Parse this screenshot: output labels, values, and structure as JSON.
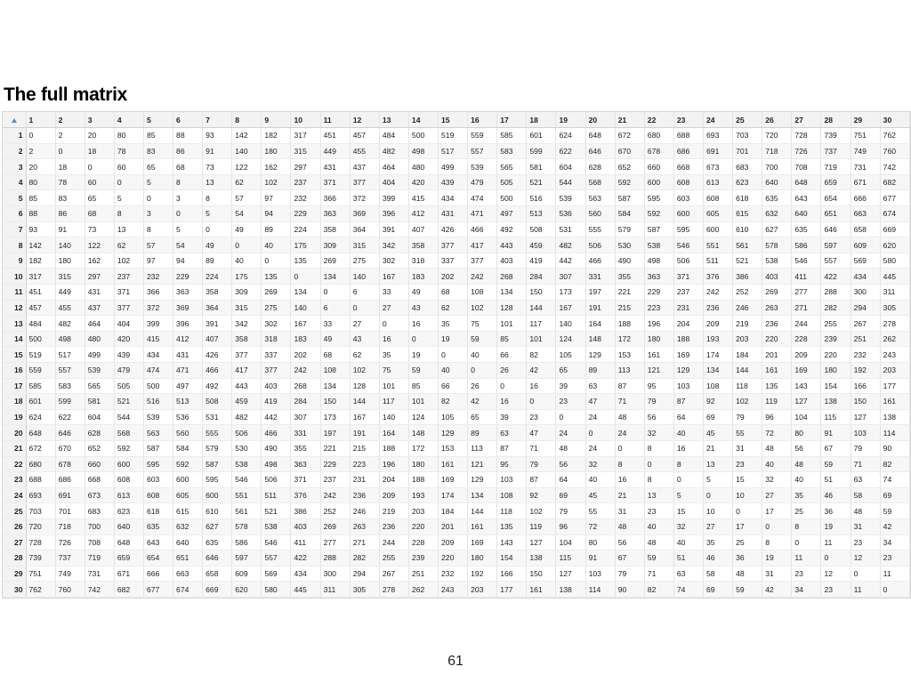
{
  "slide": {
    "title": "The full matrix",
    "page_number": "61"
  },
  "matrix": {
    "corner_icon": "sort-ascending-icon",
    "columns": [
      "1",
      "2",
      "3",
      "4",
      "5",
      "6",
      "7",
      "8",
      "9",
      "10",
      "11",
      "12",
      "13",
      "14",
      "15",
      "16",
      "17",
      "18",
      "19",
      "20",
      "21",
      "22",
      "23",
      "24",
      "25",
      "26",
      "27",
      "28",
      "29",
      "30"
    ],
    "rows": [
      {
        "label": "1",
        "cells": [
          0,
          2,
          20,
          80,
          85,
          88,
          93,
          142,
          182,
          317,
          451,
          457,
          484,
          500,
          519,
          559,
          585,
          601,
          624,
          648,
          672,
          680,
          688,
          693,
          703,
          720,
          728,
          739,
          751,
          762
        ]
      },
      {
        "label": "2",
        "cells": [
          2,
          0,
          18,
          78,
          83,
          86,
          91,
          140,
          180,
          315,
          449,
          455,
          482,
          498,
          517,
          557,
          583,
          599,
          622,
          646,
          670,
          678,
          686,
          691,
          701,
          718,
          726,
          737,
          749,
          760
        ]
      },
      {
        "label": "3",
        "cells": [
          20,
          18,
          0,
          60,
          65,
          68,
          73,
          122,
          162,
          297,
          431,
          437,
          464,
          480,
          499,
          539,
          565,
          581,
          604,
          628,
          652,
          660,
          668,
          673,
          683,
          700,
          708,
          719,
          731,
          742
        ]
      },
      {
        "label": "4",
        "cells": [
          80,
          78,
          60,
          0,
          5,
          8,
          13,
          62,
          102,
          237,
          371,
          377,
          404,
          420,
          439,
          479,
          505,
          521,
          544,
          568,
          592,
          600,
          608,
          613,
          623,
          640,
          648,
          659,
          671,
          682
        ]
      },
      {
        "label": "5",
        "cells": [
          85,
          83,
          65,
          5,
          0,
          3,
          8,
          57,
          97,
          232,
          366,
          372,
          399,
          415,
          434,
          474,
          500,
          516,
          539,
          563,
          587,
          595,
          603,
          608,
          618,
          635,
          643,
          654,
          666,
          677
        ]
      },
      {
        "label": "6",
        "cells": [
          88,
          86,
          68,
          8,
          3,
          0,
          5,
          54,
          94,
          229,
          363,
          369,
          396,
          412,
          431,
          471,
          497,
          513,
          536,
          560,
          584,
          592,
          600,
          605,
          615,
          632,
          640,
          651,
          663,
          674
        ]
      },
      {
        "label": "7",
        "cells": [
          93,
          91,
          73,
          13,
          8,
          5,
          0,
          49,
          89,
          224,
          358,
          364,
          391,
          407,
          426,
          466,
          492,
          508,
          531,
          555,
          579,
          587,
          595,
          600,
          610,
          627,
          635,
          646,
          658,
          669
        ]
      },
      {
        "label": "8",
        "cells": [
          142,
          140,
          122,
          62,
          57,
          54,
          49,
          0,
          40,
          175,
          309,
          315,
          342,
          358,
          377,
          417,
          443,
          459,
          482,
          506,
          530,
          538,
          546,
          551,
          561,
          578,
          586,
          597,
          609,
          620
        ]
      },
      {
        "label": "9",
        "cells": [
          182,
          180,
          162,
          102,
          97,
          94,
          89,
          40,
          0,
          135,
          269,
          275,
          302,
          318,
          337,
          377,
          403,
          419,
          442,
          466,
          490,
          498,
          506,
          511,
          521,
          538,
          546,
          557,
          569,
          580
        ]
      },
      {
        "label": "10",
        "cells": [
          317,
          315,
          297,
          237,
          232,
          229,
          224,
          175,
          135,
          0,
          134,
          140,
          167,
          183,
          202,
          242,
          268,
          284,
          307,
          331,
          355,
          363,
          371,
          376,
          386,
          403,
          411,
          422,
          434,
          445
        ]
      },
      {
        "label": "11",
        "cells": [
          451,
          449,
          431,
          371,
          366,
          363,
          358,
          309,
          269,
          134,
          0,
          6,
          33,
          49,
          68,
          108,
          134,
          150,
          173,
          197,
          221,
          229,
          237,
          242,
          252,
          269,
          277,
          288,
          300,
          311
        ]
      },
      {
        "label": "12",
        "cells": [
          457,
          455,
          437,
          377,
          372,
          369,
          364,
          315,
          275,
          140,
          6,
          0,
          27,
          43,
          62,
          102,
          128,
          144,
          167,
          191,
          215,
          223,
          231,
          236,
          246,
          263,
          271,
          282,
          294,
          305
        ]
      },
      {
        "label": "13",
        "cells": [
          484,
          482,
          464,
          404,
          399,
          396,
          391,
          342,
          302,
          167,
          33,
          27,
          0,
          16,
          35,
          75,
          101,
          117,
          140,
          164,
          188,
          196,
          204,
          209,
          219,
          236,
          244,
          255,
          267,
          278
        ]
      },
      {
        "label": "14",
        "cells": [
          500,
          498,
          480,
          420,
          415,
          412,
          407,
          358,
          318,
          183,
          49,
          43,
          16,
          0,
          19,
          59,
          85,
          101,
          124,
          148,
          172,
          180,
          188,
          193,
          203,
          220,
          228,
          239,
          251,
          262
        ]
      },
      {
        "label": "15",
        "cells": [
          519,
          517,
          499,
          439,
          434,
          431,
          426,
          377,
          337,
          202,
          68,
          62,
          35,
          19,
          0,
          40,
          66,
          82,
          105,
          129,
          153,
          161,
          169,
          174,
          184,
          201,
          209,
          220,
          232,
          243
        ]
      },
      {
        "label": "16",
        "cells": [
          559,
          557,
          539,
          479,
          474,
          471,
          466,
          417,
          377,
          242,
          108,
          102,
          75,
          59,
          40,
          0,
          26,
          42,
          65,
          89,
          113,
          121,
          129,
          134,
          144,
          161,
          169,
          180,
          192,
          203
        ]
      },
      {
        "label": "17",
        "cells": [
          585,
          583,
          565,
          505,
          500,
          497,
          492,
          443,
          403,
          268,
          134,
          128,
          101,
          85,
          66,
          26,
          0,
          16,
          39,
          63,
          87,
          95,
          103,
          108,
          118,
          135,
          143,
          154,
          166,
          177
        ]
      },
      {
        "label": "18",
        "cells": [
          601,
          599,
          581,
          521,
          516,
          513,
          508,
          459,
          419,
          284,
          150,
          144,
          117,
          101,
          82,
          42,
          16,
          0,
          23,
          47,
          71,
          79,
          87,
          92,
          102,
          119,
          127,
          138,
          150,
          161
        ]
      },
      {
        "label": "19",
        "cells": [
          624,
          622,
          604,
          544,
          539,
          536,
          531,
          482,
          442,
          307,
          173,
          167,
          140,
          124,
          105,
          65,
          39,
          23,
          0,
          24,
          48,
          56,
          64,
          69,
          79,
          96,
          104,
          115,
          127,
          138
        ]
      },
      {
        "label": "20",
        "cells": [
          648,
          646,
          628,
          568,
          563,
          560,
          555,
          506,
          466,
          331,
          197,
          191,
          164,
          148,
          129,
          89,
          63,
          47,
          24,
          0,
          24,
          32,
          40,
          45,
          55,
          72,
          80,
          91,
          103,
          114
        ]
      },
      {
        "label": "21",
        "cells": [
          672,
          670,
          652,
          592,
          587,
          584,
          579,
          530,
          490,
          355,
          221,
          215,
          188,
          172,
          153,
          113,
          87,
          71,
          48,
          24,
          0,
          8,
          16,
          21,
          31,
          48,
          56,
          67,
          79,
          90
        ]
      },
      {
        "label": "22",
        "cells": [
          680,
          678,
          660,
          600,
          595,
          592,
          587,
          538,
          498,
          363,
          229,
          223,
          196,
          180,
          161,
          121,
          95,
          79,
          56,
          32,
          8,
          0,
          8,
          13,
          23,
          40,
          48,
          59,
          71,
          82
        ]
      },
      {
        "label": "23",
        "cells": [
          688,
          686,
          668,
          608,
          603,
          600,
          595,
          546,
          506,
          371,
          237,
          231,
          204,
          188,
          169,
          129,
          103,
          87,
          64,
          40,
          16,
          8,
          0,
          5,
          15,
          32,
          40,
          51,
          63,
          74
        ]
      },
      {
        "label": "24",
        "cells": [
          693,
          691,
          673,
          613,
          608,
          605,
          600,
          551,
          511,
          376,
          242,
          236,
          209,
          193,
          174,
          134,
          108,
          92,
          69,
          45,
          21,
          13,
          5,
          0,
          10,
          27,
          35,
          46,
          58,
          69
        ]
      },
      {
        "label": "25",
        "cells": [
          703,
          701,
          683,
          623,
          618,
          615,
          610,
          561,
          521,
          386,
          252,
          246,
          219,
          203,
          184,
          144,
          118,
          102,
          79,
          55,
          31,
          23,
          15,
          10,
          0,
          17,
          25,
          36,
          48,
          59
        ]
      },
      {
        "label": "26",
        "cells": [
          720,
          718,
          700,
          640,
          635,
          632,
          627,
          578,
          538,
          403,
          269,
          263,
          236,
          220,
          201,
          161,
          135,
          119,
          96,
          72,
          48,
          40,
          32,
          27,
          17,
          0,
          8,
          19,
          31,
          42
        ]
      },
      {
        "label": "27",
        "cells": [
          728,
          726,
          708,
          648,
          643,
          640,
          635,
          586,
          546,
          411,
          277,
          271,
          244,
          228,
          209,
          169,
          143,
          127,
          104,
          80,
          56,
          48,
          40,
          35,
          25,
          8,
          0,
          11,
          23,
          34
        ]
      },
      {
        "label": "28",
        "cells": [
          739,
          737,
          719,
          659,
          654,
          651,
          646,
          597,
          557,
          422,
          288,
          282,
          255,
          239,
          220,
          180,
          154,
          138,
          115,
          91,
          67,
          59,
          51,
          46,
          36,
          19,
          11,
          0,
          12,
          23
        ]
      },
      {
        "label": "29",
        "cells": [
          751,
          749,
          731,
          671,
          666,
          663,
          658,
          609,
          569,
          434,
          300,
          294,
          267,
          251,
          232,
          192,
          166,
          150,
          127,
          103,
          79,
          71,
          63,
          58,
          48,
          31,
          23,
          12,
          0,
          11
        ]
      },
      {
        "label": "30",
        "cells": [
          762,
          760,
          742,
          682,
          677,
          674,
          669,
          620,
          580,
          445,
          311,
          305,
          278,
          262,
          243,
          203,
          177,
          161,
          138,
          114,
          90,
          82,
          74,
          69,
          59,
          42,
          34,
          23,
          11,
          0
        ]
      }
    ]
  }
}
